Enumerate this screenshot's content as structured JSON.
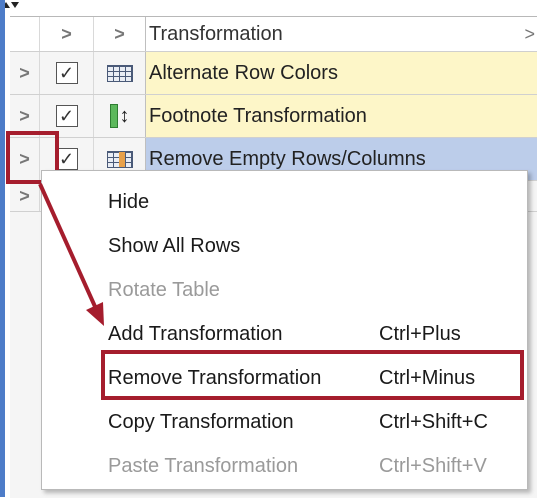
{
  "grid": {
    "header": {
      "column_label": "Transformation",
      "expand_glyph": ">",
      "right_glyph": ">"
    },
    "rows": [
      {
        "label": "Alternate Row Colors",
        "icon": "table-grid-icon",
        "checked": true
      },
      {
        "label": "Footnote Transformation",
        "icon": "footnote-icon",
        "checked": true
      },
      {
        "label": "Remove Empty Rows/Columns",
        "icon": "table-grid-orange-icon",
        "checked": true
      }
    ],
    "expand_glyph": ">"
  },
  "context_menu": {
    "items": [
      {
        "label": "Hide",
        "shortcut": "",
        "enabled": true
      },
      {
        "label": "Show All Rows",
        "shortcut": "",
        "enabled": true
      },
      {
        "label": "Rotate Table",
        "shortcut": "",
        "enabled": false
      },
      {
        "label": "Add Transformation",
        "shortcut": "Ctrl+Plus",
        "enabled": true
      },
      {
        "label": "Remove Transformation",
        "shortcut": "Ctrl+Minus",
        "enabled": true
      },
      {
        "label": "Copy Transformation",
        "shortcut": "Ctrl+Shift+C",
        "enabled": true
      },
      {
        "label": "Paste Transformation",
        "shortcut": "Ctrl+Shift+V",
        "enabled": false
      }
    ]
  },
  "colors": {
    "row_highlight": "#fdf6c8",
    "row_selected": "#bccdea",
    "annotation": "#a51d2d"
  }
}
